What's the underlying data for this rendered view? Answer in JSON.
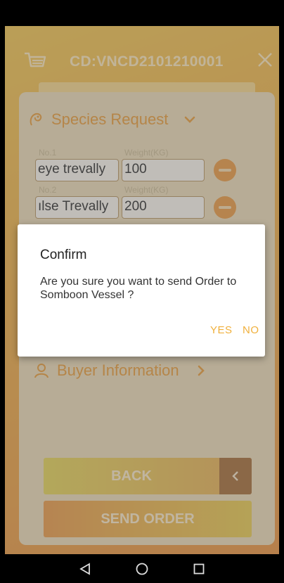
{
  "header": {
    "order_code": "CD:VNCD2101210001",
    "cart_icon": "cart-icon",
    "close_icon": "close-icon"
  },
  "species_section": {
    "label": "Species Request",
    "icon": "fish-icon",
    "rows": [
      {
        "no_label": "No.1",
        "weight_label": "Weight(KG)",
        "name": "eye trevally",
        "weight": "100"
      },
      {
        "no_label": "No.2",
        "weight_label": "Weight(KG)",
        "name": "ılse Trevally",
        "weight": "200"
      }
    ]
  },
  "buyer_section": {
    "label": "Buyer Information",
    "icon": "user-icon"
  },
  "buttons": {
    "back": "BACK",
    "send_order": "SEND ORDER"
  },
  "dialog": {
    "title": "Confirm",
    "message": "Are you sure you want to send Order to Somboon Vessel ?",
    "yes": "YES",
    "no": "NO"
  },
  "colors": {
    "accent": "#e9962e",
    "dialog_button": "#f0b03c",
    "back_arrow_bg": "#a0652b"
  }
}
